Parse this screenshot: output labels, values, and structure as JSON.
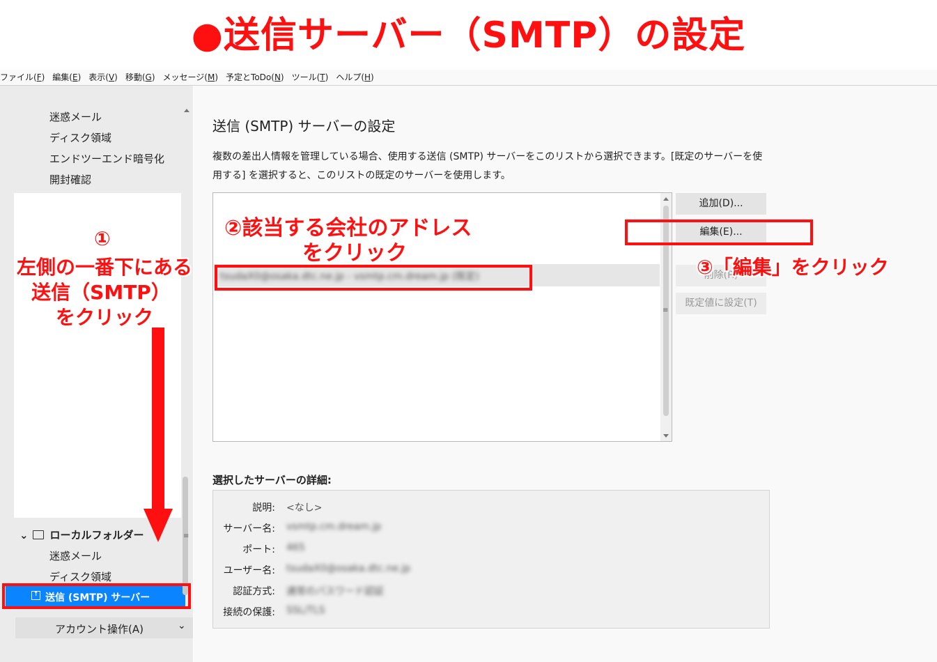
{
  "banner": {
    "title": "●送信サーバー（SMTP）の設定"
  },
  "menu": [
    {
      "label": "ファイル(",
      "key": "F",
      "end": ")"
    },
    {
      "label": "編集(",
      "key": "E",
      "end": ")"
    },
    {
      "label": "表示(",
      "key": "V",
      "end": ")"
    },
    {
      "label": "移動(",
      "key": "G",
      "end": ")"
    },
    {
      "label": "メッセージ(",
      "key": "M",
      "end": ")"
    },
    {
      "label": "予定とToDo(",
      "key": "N",
      "end": ")"
    },
    {
      "label": "ツール(",
      "key": "T",
      "end": ")"
    },
    {
      "label": "ヘルプ(",
      "key": "H",
      "end": ")"
    }
  ],
  "sidebar": {
    "top_items": [
      "迷惑メール",
      "ディスク領域",
      "エンドツーエンド暗号化",
      "開封確認"
    ],
    "folder": "ローカルフォルダー",
    "folder_items": [
      "迷惑メール",
      "ディスク領域"
    ],
    "smtp": "送信 (SMTP) サーバー",
    "account_btn": "アカウント操作(A)"
  },
  "main": {
    "title": "送信 (SMTP) サーバーの設定",
    "desc": "複数の差出人情報を管理している場合、使用する送信 (SMTP) サーバーをこのリストから選択できます。[既定のサーバーを使用する] を選択すると、このリストの既定のサーバーを使用します。",
    "list_item": "tsudaX0@osaka.dtc.ne.jp - vsmtp.cm.dream.jp (既定)",
    "buttons": {
      "add": "追加(D)...",
      "edit": "編集(E)...",
      "delete": "削除(R)",
      "default": "既定値に設定(T)"
    },
    "details_title": "選択したサーバーの詳細:",
    "details": [
      {
        "label": "説明:",
        "value": "<なし>",
        "blur": false
      },
      {
        "label": "サーバー名:",
        "value": "vsmtp.cm.dream.jp",
        "blur": true
      },
      {
        "label": "ポート:",
        "value": "465",
        "blur": true
      },
      {
        "label": "ユーザー名:",
        "value": "tsudaX0@osaka.dtc.ne.jp",
        "blur": true
      },
      {
        "label": "認証方式:",
        "value": "通常のパスワード認証",
        "blur": true
      },
      {
        "label": "接続の保護:",
        "value": "SSL/TLS",
        "blur": true
      }
    ]
  },
  "annotations": {
    "step1": [
      "①",
      "左側の一番下にある",
      "送信（SMTP）",
      "をクリック"
    ],
    "step2": [
      "②該当する会社のアドレス",
      "をクリック"
    ],
    "step3": "③「編集」をクリック"
  },
  "colors": {
    "annotation_red": "#ff1010",
    "selection_blue": "#0a84ff"
  }
}
